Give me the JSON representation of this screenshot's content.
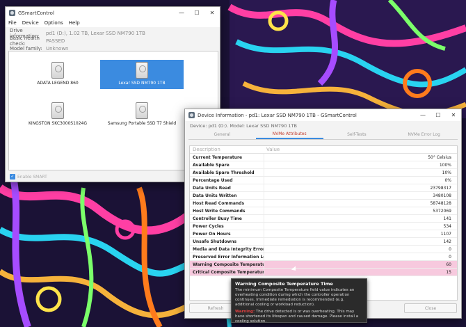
{
  "main_window": {
    "title": "GSmartControl",
    "controls": {
      "minimize": "—",
      "maximize": "☐",
      "close": "✕"
    },
    "menu": [
      "File",
      "Device",
      "Options",
      "Help"
    ],
    "drive_info": [
      {
        "label": "Drive information:",
        "value": "pd1 (D:), 1.02 TB, Lexar SSD NM790 1TB"
      },
      {
        "label": "Basic health check:",
        "value": "PASSED"
      },
      {
        "label": "Model family:",
        "value": "Unknown"
      }
    ],
    "devices": [
      {
        "name": "ADATA LEGEND 860",
        "selected": false
      },
      {
        "name": "Lexar SSD NM790 1TB",
        "selected": true
      },
      {
        "name": "KINGSTON SKC3000S1024G",
        "selected": false
      },
      {
        "name": "Samsung Portable SSD T7 Shield",
        "selected": false
      }
    ],
    "enable_smart": {
      "label": "Enable SMART",
      "checked": true
    }
  },
  "info_window": {
    "title": "Device Information - pd1: Lexar SSD NM790 1TB - GSmartControl",
    "controls": {
      "minimize": "—",
      "maximize": "☐",
      "close": "✕"
    },
    "device_line": {
      "label": "Device:",
      "device": "pd1 (D:).",
      "model_label": "Model:",
      "model": "Lexar SSD NM790 1TB"
    },
    "tabs": [
      {
        "label": "General",
        "active": false
      },
      {
        "label": "NVMe Attributes",
        "active": true
      },
      {
        "label": "Self-Tests",
        "active": false
      },
      {
        "label": "NVMe Error Log",
        "active": false
      }
    ],
    "table": {
      "headers": [
        "Description",
        "Value"
      ],
      "rows": [
        {
          "description": "Current Temperature",
          "value": "50° Celsius",
          "warn": false
        },
        {
          "description": "Available Spare",
          "value": "100%",
          "warn": false
        },
        {
          "description": "Available Spare Threshold",
          "value": "10%",
          "warn": false
        },
        {
          "description": "Percentage Used",
          "value": "0%",
          "warn": false
        },
        {
          "description": "Data Units Read",
          "value": "23798317",
          "warn": false
        },
        {
          "description": "Data Units Written",
          "value": "3480108",
          "warn": false
        },
        {
          "description": "Host Read Commands",
          "value": "58748128",
          "warn": false
        },
        {
          "description": "Host Write Commands",
          "value": "5372069",
          "warn": false
        },
        {
          "description": "Controller Busy Time",
          "value": "141",
          "warn": false
        },
        {
          "description": "Power Cycles",
          "value": "534",
          "warn": false
        },
        {
          "description": "Power On Hours",
          "value": "1107",
          "warn": false
        },
        {
          "description": "Unsafe Shutdowns",
          "value": "142",
          "warn": false
        },
        {
          "description": "Media and Data Integrity Errors",
          "value": "0",
          "warn": false
        },
        {
          "description": "Preserved Error Information Log Entries",
          "value": "0",
          "warn": false
        },
        {
          "description": "Warning  Composite Temperature Time",
          "value": "60",
          "warn": true
        },
        {
          "description": "Critical Composite Temperature Time",
          "value": "15",
          "warn": true
        }
      ]
    },
    "buttons": {
      "refresh": "Refresh",
      "close": "Close"
    }
  },
  "tooltip": {
    "title": "Warning  Composite Temperature Time",
    "body": "The minimum Composite Temperature field value indicates an overheating condition during which the controller operation continues. Immediate remediation is recommended (e.g. additional cooling or workload reduction).",
    "warning_label": "Warning:",
    "warning_text": "The drive detected is or was overheating. This may have shortened its lifespan and caused damage. Please install a cooling solution."
  },
  "colors": {
    "selection": "#3b8be0",
    "warn_row": "#f7c9de",
    "active_tab": "#c0392b"
  }
}
